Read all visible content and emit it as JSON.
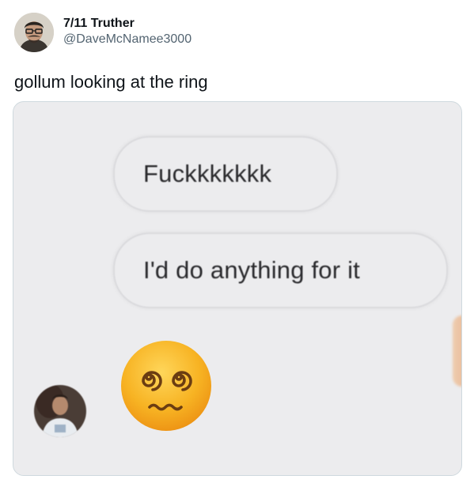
{
  "author": {
    "display_name": "7/11 Truther",
    "handle": "@DaveMcNamee3000",
    "avatar_icon": "profile-photo-icon"
  },
  "tweet": {
    "text": "gollum looking at the ring"
  },
  "media": {
    "messages": [
      {
        "text": "Fuckkkkkkk"
      },
      {
        "text": "I'd do anything for it"
      }
    ],
    "reaction_emoji": "face-with-spiral-eyes-icon",
    "sender_avatar": "contact-photo-icon",
    "colors": {
      "bubble_background": "#ececee",
      "bubble_border": "#dadadd",
      "emoji_yellow": "#f7b323"
    }
  }
}
